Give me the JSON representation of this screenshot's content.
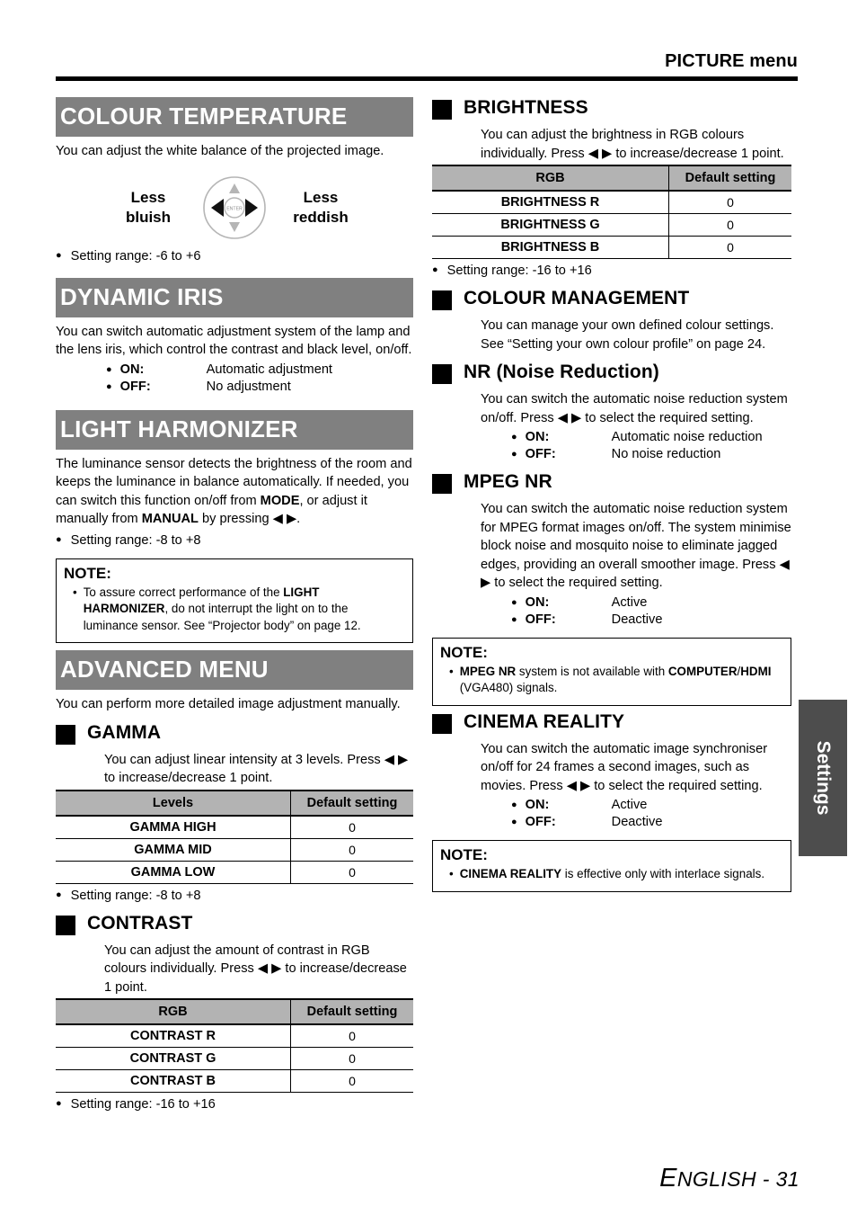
{
  "header": {
    "title": "PICTURE menu"
  },
  "footer": {
    "lang_first": "E",
    "lang_rest": "NGLISH",
    "separator": " - ",
    "page": "31"
  },
  "side_tab": {
    "label": "Settings"
  },
  "left_column": {
    "colour_temperature": {
      "heading": "COLOUR TEMPERATURE",
      "body": "You can adjust the white balance of the projected image.",
      "diagram": {
        "left_label_line1": "Less",
        "left_label_line2": "bluish",
        "right_label_line1": "Less",
        "right_label_line2": "reddish",
        "enter_label": "ENTER"
      },
      "setting_range": "Setting range: -6 to +6"
    },
    "dynamic_iris": {
      "heading": "DYNAMIC IRIS",
      "body": "You can switch automatic adjustment system of the lamp and the lens iris, which control the contrast and black level, on/off.",
      "options": [
        {
          "key": "ON:",
          "value": "Automatic adjustment"
        },
        {
          "key": "OFF:",
          "value": "No adjustment"
        }
      ]
    },
    "light_harmonizer": {
      "heading": "LIGHT HARMONIZER",
      "body_part1": "The luminance sensor detects the brightness of the room and keeps the luminance in balance automatically. If needed, you can switch this function on/off from ",
      "body_bold1": "MODE",
      "body_part2": ", or adjust it manually from ",
      "body_bold2": "MANUAL",
      "body_part3": " by pressing ◀ ▶.",
      "setting_range": "Setting range: -8 to +8",
      "note": {
        "title": "NOTE:",
        "item_part1": "To assure correct performance of the ",
        "item_bold1": "LIGHT HARMONIZER",
        "item_part2": ", do not interrupt the light on to the luminance sensor. See “Projector body” on page 12."
      }
    },
    "advanced_menu": {
      "heading": "ADVANCED MENU",
      "body": "You can perform more detailed image adjustment manually.",
      "gamma": {
        "title": "GAMMA",
        "body": "You can adjust linear intensity at 3 levels. Press ◀ ▶ to increase/decrease 1 point.",
        "table": {
          "columns": [
            "Levels",
            "Default setting"
          ],
          "rows": [
            {
              "name": "GAMMA HIGH",
              "value": "0"
            },
            {
              "name": "GAMMA MID",
              "value": "0"
            },
            {
              "name": "GAMMA LOW",
              "value": "0"
            }
          ]
        },
        "setting_range": "Setting range: -8 to +8"
      },
      "contrast": {
        "title": "CONTRAST",
        "body": "You can adjust the amount of contrast in RGB colours individually. Press ◀ ▶ to increase/decrease 1 point.",
        "table": {
          "columns": [
            "RGB",
            "Default setting"
          ],
          "rows": [
            {
              "name": "CONTRAST R",
              "value": "0"
            },
            {
              "name": "CONTRAST G",
              "value": "0"
            },
            {
              "name": "CONTRAST B",
              "value": "0"
            }
          ]
        },
        "setting_range": "Setting range: -16 to +16"
      }
    }
  },
  "right_column": {
    "brightness": {
      "title": "BRIGHTNESS",
      "body": "You can adjust the brightness in RGB colours individually. Press ◀ ▶ to increase/decrease 1 point.",
      "table": {
        "columns": [
          "RGB",
          "Default setting"
        ],
        "rows": [
          {
            "name": "BRIGHTNESS R",
            "value": "0"
          },
          {
            "name": "BRIGHTNESS G",
            "value": "0"
          },
          {
            "name": "BRIGHTNESS B",
            "value": "0"
          }
        ]
      },
      "setting_range": "Setting range: -16 to +16"
    },
    "colour_management": {
      "title": "COLOUR MANAGEMENT",
      "body": "You can manage your own defined colour settings. See “Setting your own colour profile” on page 24."
    },
    "nr": {
      "title": "NR (Noise Reduction)",
      "body": "You can switch the automatic noise reduction system on/off. Press ◀ ▶ to select the required setting.",
      "options": [
        {
          "key": "ON:",
          "value": "Automatic noise reduction"
        },
        {
          "key": "OFF:",
          "value": "No noise reduction"
        }
      ]
    },
    "mpeg_nr": {
      "title": "MPEG NR",
      "body": "You can switch the automatic noise reduction system for MPEG format images on/off. The system minimise block noise and mosquito noise to eliminate jagged edges, providing an overall smoother image. Press ◀ ▶ to select the required setting.",
      "options": [
        {
          "key": "ON:",
          "value": "Active"
        },
        {
          "key": "OFF:",
          "value": "Deactive"
        }
      ],
      "note": {
        "title": "NOTE:",
        "item_bold1": "MPEG NR",
        "item_part1": " system is not available with ",
        "item_bold2": "COMPUTER",
        "item_part2": "/",
        "item_bold3": "HDMI",
        "item_part3": " (VGA480) signals."
      }
    },
    "cinema_reality": {
      "title": "CINEMA REALITY",
      "body": "You can switch the automatic image synchroniser on/off for 24 frames a second images, such as movies. Press ◀ ▶ to select the required setting.",
      "options": [
        {
          "key": "ON:",
          "value": "Active"
        },
        {
          "key": "OFF:",
          "value": "Deactive"
        }
      ],
      "note": {
        "title": "NOTE:",
        "item_bold1": "CINEMA REALITY",
        "item_part1": " is effective only with interlace signals."
      }
    }
  },
  "colors": {
    "section_bar": "#808080",
    "table_header": "#b3b3b3",
    "side_tab": "#4d4d4d",
    "rule": "#000000"
  }
}
